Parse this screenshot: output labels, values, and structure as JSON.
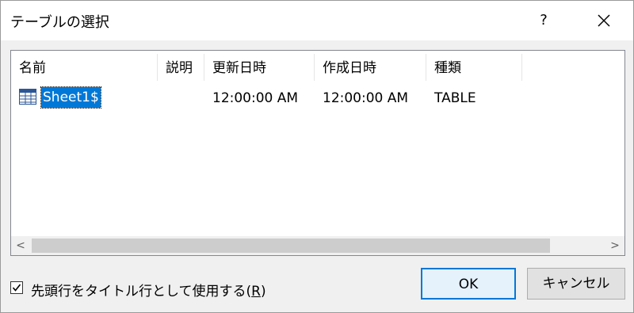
{
  "dialog": {
    "title": "テーブルの選択",
    "help_label": "?",
    "close_icon": "close-icon"
  },
  "table": {
    "columns": [
      "名前",
      "説明",
      "更新日時",
      "作成日時",
      "種類"
    ],
    "rows": [
      {
        "name": "Sheet1$",
        "description": "",
        "modified": "12:00:00 AM",
        "created": "12:00:00 AM",
        "type": "TABLE",
        "icon": "table-icon"
      }
    ]
  },
  "scrollbar": {
    "left_arrow": "<",
    "right_arrow": ">"
  },
  "options": {
    "header_checkbox_label": "先頭行をタイトル行として使用する(",
    "header_checkbox_mnemonic": "R",
    "header_checkbox_suffix": ")",
    "header_checkbox_checked": true
  },
  "buttons": {
    "ok": "OK",
    "cancel": "キャンセル"
  }
}
